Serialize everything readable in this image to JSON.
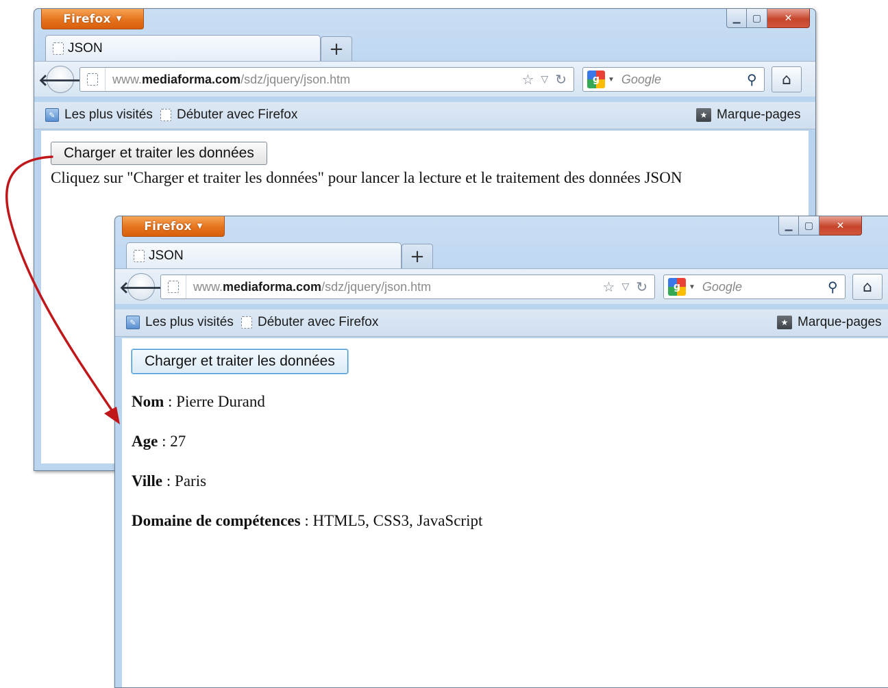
{
  "window_back": {
    "menu_button": "Firefox",
    "tab_title": "JSON",
    "new_tab": "+",
    "url": {
      "prefix": "www.",
      "domain": "mediaforma.com",
      "path": "/sdz/jquery/json.htm"
    },
    "search_placeholder": "Google",
    "bookmarks": {
      "most_visited": "Les plus visités",
      "getting_started": "Débuter avec Firefox",
      "bookmarks_menu": "Marque-pages"
    },
    "page": {
      "button_label": "Charger et traiter les données",
      "instruction": "Cliquez sur \"Charger et traiter les données\" pour lancer la lecture et le traitement des données JSON"
    }
  },
  "window_front": {
    "menu_button": "Firefox",
    "tab_title": "JSON",
    "new_tab": "+",
    "url": {
      "prefix": "www.",
      "domain": "mediaforma.com",
      "path": "/sdz/jquery/json.htm"
    },
    "search_placeholder": "Google",
    "bookmarks": {
      "most_visited": "Les plus visités",
      "getting_started": "Débuter avec Firefox",
      "bookmarks_menu": "Marque-pages"
    },
    "page": {
      "button_label": "Charger et traiter les données",
      "fields": [
        {
          "label": "Nom",
          "value": " : Pierre Durand"
        },
        {
          "label": "Age",
          "value": " : 27"
        },
        {
          "label": "Ville",
          "value": " : Paris"
        },
        {
          "label": "Domaine de compétences",
          "value": " : HTML5, CSS3, JavaScript"
        }
      ]
    }
  },
  "icons": {
    "back": "←",
    "star": "☆",
    "dropdown": "▿",
    "reload": "↻",
    "home": "⌂",
    "search": "⚲",
    "minimize": "_",
    "maximize": "▢",
    "close": "X"
  },
  "colors": {
    "arrow": "#c0171b",
    "menu_button": "#e5731d",
    "close_button": "#c6452a"
  }
}
